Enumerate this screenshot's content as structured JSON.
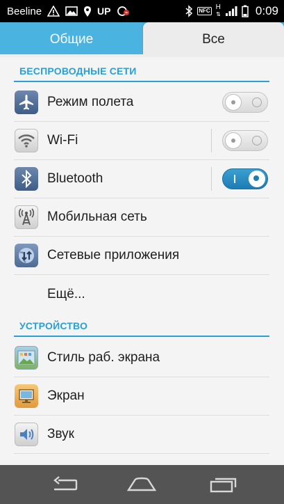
{
  "statusbar": {
    "carrier": "Beeline",
    "up_label": "UP",
    "nfc_label": "NFC",
    "network_type": "H",
    "time": "0:09"
  },
  "tabs": {
    "general": "Общие",
    "all": "Все",
    "selected": "all"
  },
  "sections": {
    "wireless": "БЕСПРОВОДНЫЕ СЕТИ",
    "device": "УСТРОЙСТВО"
  },
  "items": {
    "airplane": {
      "label": "Режим полета",
      "icon": "airplane-icon",
      "toggle": "off"
    },
    "wifi": {
      "label": "Wi-Fi",
      "icon": "wifi-icon",
      "toggle": "off"
    },
    "bluetooth": {
      "label": "Bluetooth",
      "icon": "bluetooth-icon",
      "toggle": "on"
    },
    "mobile": {
      "label": "Мобильная сеть",
      "icon": "antenna-icon"
    },
    "network_apps": {
      "label": "Сетевые приложения",
      "icon": "network-apps-icon"
    },
    "more": {
      "label": "Ещё..."
    },
    "wallpaper": {
      "label": "Стиль раб. экрана",
      "icon": "wallpaper-icon"
    },
    "display": {
      "label": "Экран",
      "icon": "display-icon"
    },
    "sound": {
      "label": "Звук",
      "icon": "speaker-icon"
    }
  },
  "colors": {
    "accent": "#2a9fd6",
    "tab_bar": "#4ab3e0",
    "toggle_on": "#1c7db5",
    "nav_bar": "#545454"
  }
}
